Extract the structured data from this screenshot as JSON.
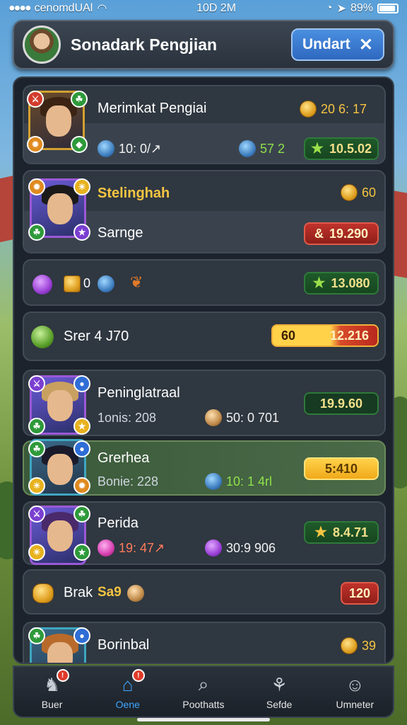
{
  "status": {
    "carrier": "cenomdUAl",
    "time": "10D 2M",
    "battery": "89%"
  },
  "header": {
    "title": "Sonadark Pengjian",
    "action_label": "Undart"
  },
  "cards": [
    {
      "name": "Merimkat Pengiai",
      "top_value": "20 6: 17",
      "stat_a": "10: 0/↗",
      "stat_b": "57 2",
      "chip": "10.5.02"
    },
    {
      "name": "Stelinghah",
      "top_value": "60",
      "sub_name": "Sarnge",
      "chip": "19.290"
    },
    {
      "inline_value": "0",
      "chip": "13.080"
    },
    {
      "name": "Srer 4 J70",
      "chip_left": "60",
      "chip_right": "12.216"
    },
    {
      "name": "Peninglatraal",
      "sub": "1onis: 208",
      "stat": "50: 0 701",
      "chip": "19.9.60"
    },
    {
      "name": "Grerhea",
      "sub": "Bonie: 228",
      "stat": "10: 1 4rl",
      "chip": "5:410"
    },
    {
      "name": "Perida",
      "stat_a": "19: 47↗",
      "stat_b": "30:9 906",
      "chip": "8.4.71"
    },
    {
      "name": "Brak",
      "name_accent": "Sa9",
      "chip": "120"
    },
    {
      "name": "Borinbal",
      "top_value": "39"
    }
  ],
  "nav": [
    {
      "label": "Buer",
      "icon": "knight-helmet-icon",
      "notify": "!"
    },
    {
      "label": "Oene",
      "icon": "home-icon",
      "notify": "!"
    },
    {
      "label": "Poothatts",
      "icon": "search-icon"
    },
    {
      "label": "Sefde",
      "icon": "creature-icon"
    },
    {
      "label": "Umneter",
      "icon": "user-icon"
    }
  ],
  "colors": {
    "accent_blue": "#3fa6ff",
    "chip_green": "#1f5a2a",
    "chip_red": "#c0322a",
    "chip_yellow": "#ffd24a",
    "gold": "#f5c542"
  }
}
